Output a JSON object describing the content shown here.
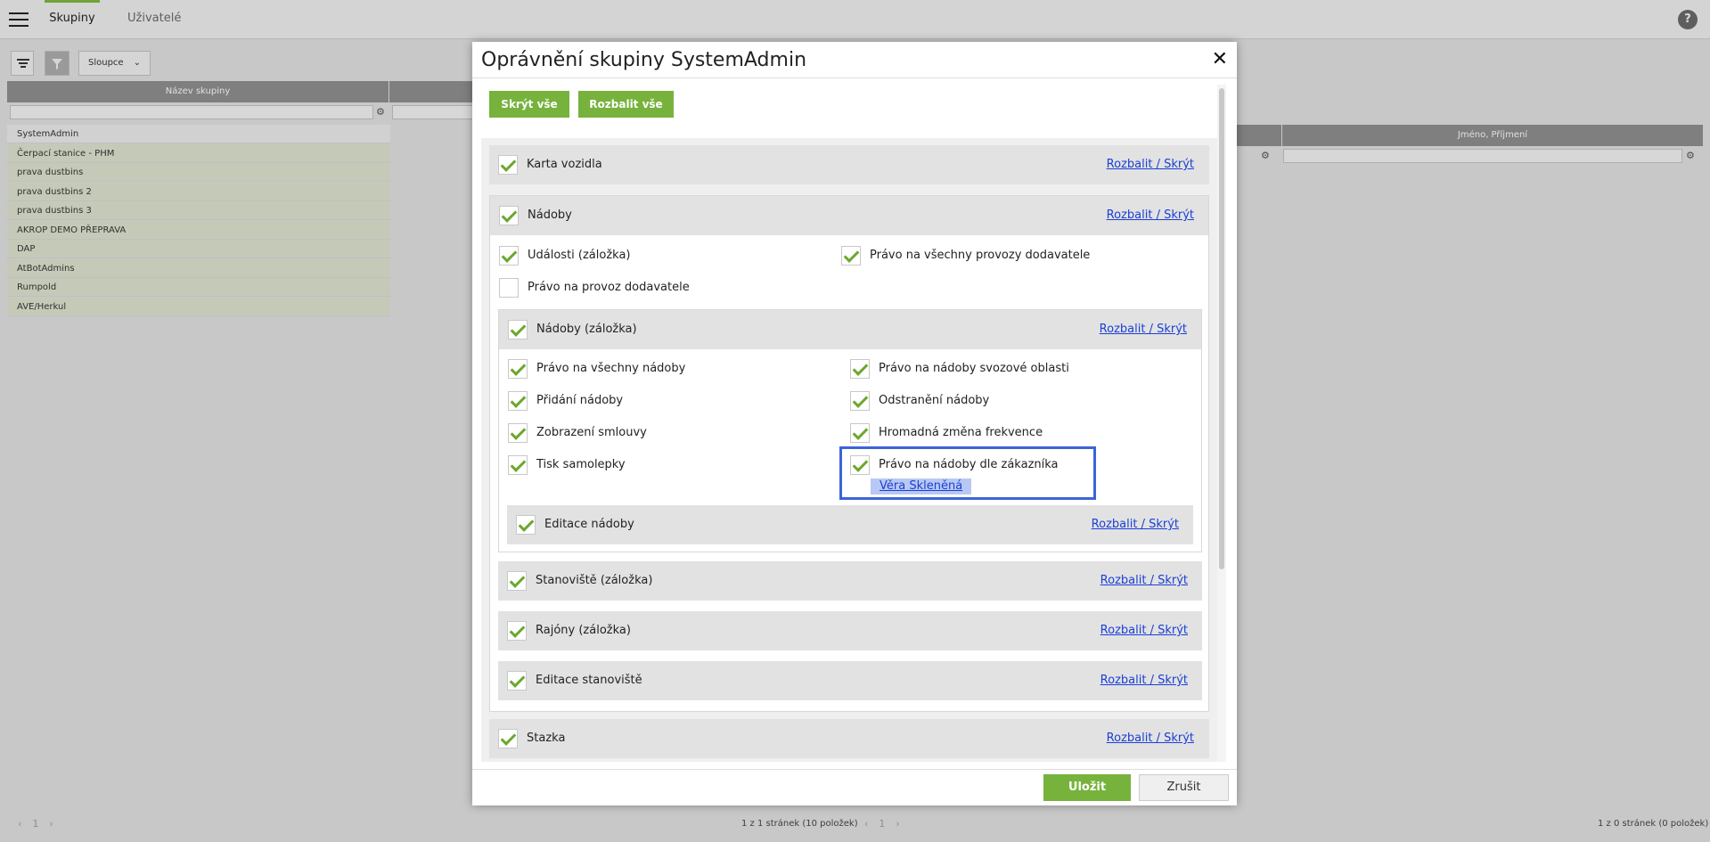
{
  "app": {
    "tabs": [
      {
        "label": "Skupiny",
        "active": true
      },
      {
        "label": "Uživatelé",
        "active": false
      }
    ],
    "help_icon": "?",
    "toolbar": {
      "columns_label": "Sloupce"
    },
    "left_grid": {
      "header": "Název skupiny",
      "rows": [
        "SystemAdmin",
        "Čerpací stanice - PHM",
        "prava dustbins",
        "prava dustbins 2",
        "prava dustbins 3",
        "AKROP DEMO PŘEPRAVA",
        "DAP",
        "AtBotAdmins",
        "Rumpold",
        "AVE/Herkul"
      ],
      "pager_text": "1 z 1 stránek (10 položek)"
    },
    "right_grid": {
      "header": "Jméno, Příjmení",
      "pager_text": "1 z 0 stránek (0 položek)"
    }
  },
  "modal": {
    "title": "Oprávnění skupiny SystemAdmin",
    "close_symbol": "✕",
    "hide_all_label": "Skrýt vše",
    "expand_all_label": "Rozbalit vše",
    "toggle_link": "Rozbalit / Skrýt",
    "sections": {
      "karta": {
        "label": "Karta vozidla",
        "checked": true
      },
      "nadoby": {
        "label": "Nádoby",
        "checked": true
      },
      "udalosti": {
        "label": "Události (záložka)",
        "checked": true
      },
      "vsechny_provozy": {
        "label": "Právo na všechny provozy dodavatele",
        "checked": true
      },
      "provoz": {
        "label": "Právo na provoz dodavatele",
        "checked": false
      },
      "nadoby_zalozka": {
        "label": "Nádoby (záložka)",
        "checked": true
      },
      "vsechny_nadoby": {
        "label": "Právo na všechny nádoby",
        "checked": true
      },
      "svozove": {
        "label": "Právo na nádoby svozové oblasti",
        "checked": true
      },
      "pridani": {
        "label": "Přidání nádoby",
        "checked": true
      },
      "odstraneni": {
        "label": "Odstranění nádoby",
        "checked": true
      },
      "smlouvy": {
        "label": "Zobrazení smlouvy",
        "checked": true
      },
      "frekvence": {
        "label": "Hromadná změna frekvence",
        "checked": true
      },
      "tisk": {
        "label": "Tisk samolepky",
        "checked": true
      },
      "zakaznik": {
        "label": "Právo na nádoby dle zákazníka",
        "checked": true,
        "user_tag": "Věra Skleněná"
      },
      "editace_nadoby": {
        "label": "Editace nádoby",
        "checked": true
      },
      "stanoviste": {
        "label": "Stanoviště (záložka)",
        "checked": true
      },
      "rajony": {
        "label": "Rajóny (záložka)",
        "checked": true
      },
      "editace_stanoviste": {
        "label": "Editace stanoviště",
        "checked": true
      },
      "stazka": {
        "label": "Stazka",
        "checked": true
      }
    },
    "save_label": "Uložit",
    "cancel_label": "Zrušit"
  }
}
